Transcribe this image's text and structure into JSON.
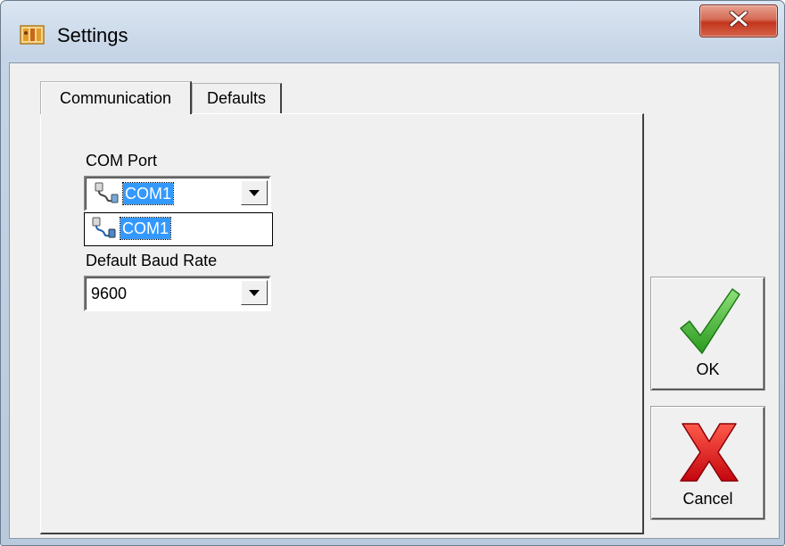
{
  "window": {
    "title": "Settings",
    "app_icon": "settings-app-icon",
    "close_icon": "close-icon",
    "close_color": "#c2351c"
  },
  "tabs": [
    {
      "label": "Communication",
      "active": true
    },
    {
      "label": "Defaults",
      "active": false
    }
  ],
  "communication": {
    "com_port": {
      "label": "COM Port",
      "value": "COM1",
      "icon": "serial-port-icon",
      "dropdown_options": [
        "COM1"
      ]
    },
    "baud_rate": {
      "label": "Default Baud Rate",
      "value": "9600"
    }
  },
  "buttons": {
    "ok": {
      "label": "OK",
      "icon": "checkmark-icon",
      "color": "#3cb026"
    },
    "cancel": {
      "label": "Cancel",
      "icon": "x-icon",
      "color": "#e0101a"
    }
  },
  "colors": {
    "selection": "#3399ff",
    "client_background": "#f0f0f0"
  }
}
